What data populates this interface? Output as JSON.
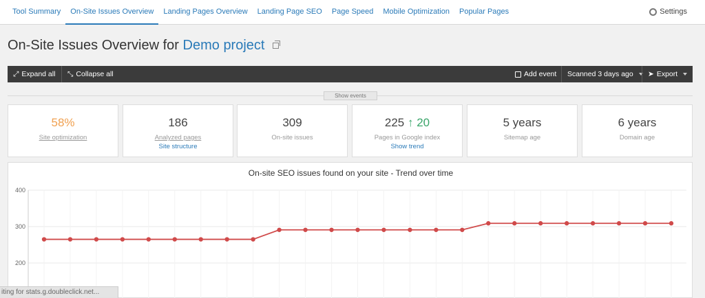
{
  "nav": {
    "tabs": [
      {
        "label": "Tool Summary"
      },
      {
        "label": "On-Site Issues Overview"
      },
      {
        "label": "Landing Pages Overview"
      },
      {
        "label": "Landing Page SEO"
      },
      {
        "label": "Page Speed"
      },
      {
        "label": "Mobile Optimization"
      },
      {
        "label": "Popular Pages"
      }
    ],
    "active_tab": "On-Site Issues Overview",
    "settings_label": "Settings"
  },
  "page": {
    "title_prefix": "On-Site Issues Overview for",
    "project_name": "Demo project"
  },
  "toolbar": {
    "expand_all": "Expand all",
    "collapse_all": "Collapse all",
    "add_event": "Add event",
    "scanned": "Scanned 3 days ago",
    "export": "Export"
  },
  "show_events": "Show events",
  "cards": [
    {
      "value": "58%",
      "label": "Site optimization"
    },
    {
      "value": "186",
      "label": "Analyzed pages",
      "link": "Site structure"
    },
    {
      "value": "309",
      "label": "On-site issues"
    },
    {
      "value": "225",
      "delta_arrow": "↑",
      "delta": "20",
      "label": "Pages in Google index",
      "link": "Show trend"
    },
    {
      "value": "5 years",
      "label": "Sitemap age"
    },
    {
      "value": "6 years",
      "label": "Domain age"
    }
  ],
  "accent": "#2a7ab8",
  "chart_data": {
    "type": "line",
    "title": "On-site SEO issues found on your site - Trend over time",
    "ylim": [
      150,
      400
    ],
    "yticks": [
      200,
      300,
      400
    ],
    "grid": true,
    "series": [
      {
        "color": "#d04a4a",
        "values": [
          265,
          265,
          265,
          265,
          265,
          265,
          265,
          265,
          265,
          291,
          291,
          291,
          291,
          291,
          291,
          291,
          291,
          309,
          309,
          309,
          309,
          309,
          309,
          309,
          309
        ]
      }
    ]
  },
  "status_text": "iting for stats.g.doubleclick.net..."
}
